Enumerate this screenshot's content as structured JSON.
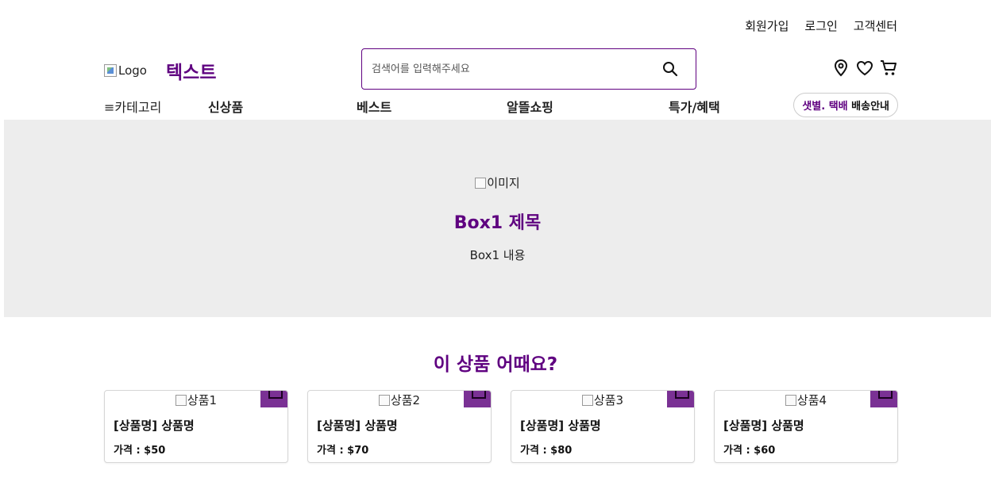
{
  "top_links": [
    "회원가입",
    "로그인",
    "고객센터"
  ],
  "header": {
    "logo_alt": "Logo",
    "logo_text": "텍스트",
    "search_placeholder": "검색어를 입력해주세요"
  },
  "icons": {
    "search": "search-icon",
    "location": "map-pin-icon",
    "wishlist": "heart-icon",
    "cart": "cart-icon"
  },
  "nav": {
    "category": "≡카테고리",
    "items": [
      "신상품",
      "베스트",
      "알뜰쇼핑",
      "특가/혜택"
    ],
    "delivery_prefix": "샛별. 택배",
    "delivery_suffix": "배송안내"
  },
  "hero": {
    "image_alt": "이미지",
    "title": "Box1 제목",
    "content": "Box1 내용"
  },
  "recommend": {
    "title": "이 상품 어때요?",
    "products": [
      {
        "image_alt": "상품1",
        "name": "[상품명] 상품명",
        "price": "가격 : $50"
      },
      {
        "image_alt": "상품2",
        "name": "[상품명] 상품명",
        "price": "가격 : $70"
      },
      {
        "image_alt": "상품3",
        "name": "[상품명] 상품명",
        "price": "가격 : $80"
      },
      {
        "image_alt": "상품4",
        "name": "[상품명] 상품명",
        "price": "가격 : $60"
      }
    ]
  },
  "colors": {
    "brand": "#5f0080",
    "cart_button": "#7a3194",
    "hero_bg": "#ededed"
  }
}
